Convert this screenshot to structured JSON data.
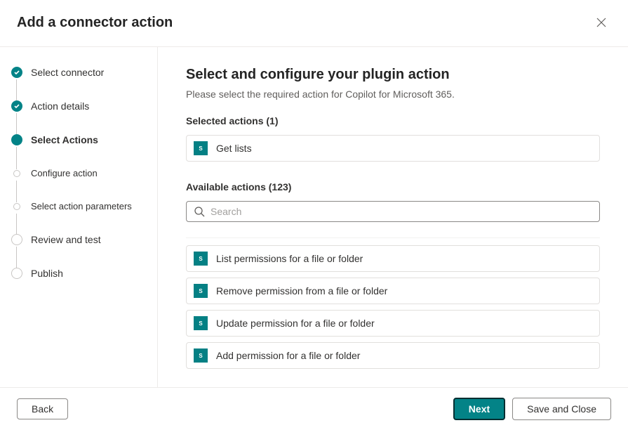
{
  "header": {
    "title": "Add a connector action"
  },
  "steps": [
    {
      "label": "Select connector",
      "state": "completed"
    },
    {
      "label": "Action details",
      "state": "completed"
    },
    {
      "label": "Select Actions",
      "state": "current"
    },
    {
      "label": "Configure action",
      "state": "upcoming-small"
    },
    {
      "label": "Select action parameters",
      "state": "upcoming-small"
    },
    {
      "label": "Review and test",
      "state": "upcoming-large"
    },
    {
      "label": "Publish",
      "state": "upcoming-large"
    }
  ],
  "main": {
    "heading": "Select and configure your plugin action",
    "description": "Please select the required action for Copilot for Microsoft 365.",
    "selectedLabel": "Selected actions (1)",
    "availableLabel": "Available actions (123)",
    "searchPlaceholder": "Search",
    "selected": [
      {
        "icon": "S",
        "title": "Get lists"
      }
    ],
    "available": [
      {
        "icon": "S",
        "title": "List permissions for a file or folder"
      },
      {
        "icon": "S",
        "title": "Remove permission from a file or folder"
      },
      {
        "icon": "S",
        "title": "Update permission for a file or folder"
      },
      {
        "icon": "S",
        "title": "Add permission for a file or folder"
      }
    ]
  },
  "footer": {
    "back": "Back",
    "next": "Next",
    "saveClose": "Save and Close"
  }
}
